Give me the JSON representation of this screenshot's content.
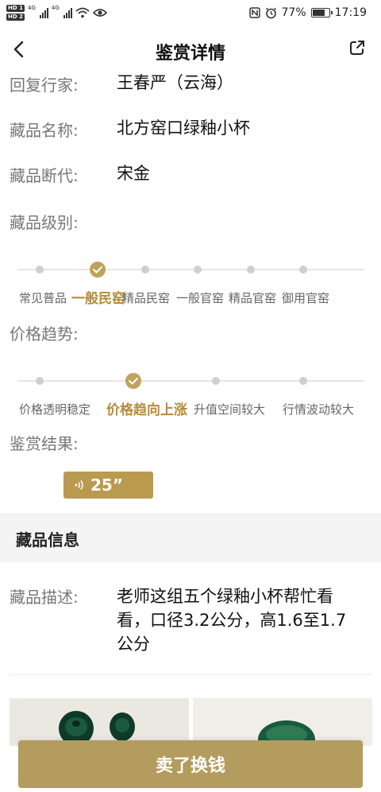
{
  "status_bar": {
    "hd1": "HD 1",
    "hd2": "HD 2",
    "net1": "4G",
    "net2": "4G",
    "battery": "77%",
    "battery_level": 0.77,
    "time": "17:19"
  },
  "header": {
    "title": "鉴赏详情"
  },
  "fields": {
    "expert_label": "回复行家:",
    "expert_value": "王春严（云海）",
    "name_label": "藏品名称:",
    "name_value": "北方窑口绿釉小杯",
    "dating_label": "藏品断代:",
    "dating_value": "宋金",
    "level_label": "藏品级别:",
    "trend_label": "价格趋势:",
    "result_label": "鉴赏结果:"
  },
  "level_steps": {
    "options": [
      "常见普品",
      "一般民窑",
      "精品民窑",
      "一般官窑",
      "精品官窑",
      "御用官窑"
    ],
    "selected_index": 1
  },
  "trend_steps": {
    "options": [
      "价格透明稳定",
      "价格趋向上涨",
      "升值空间较大",
      "行情波动较大"
    ],
    "selected_index": 1
  },
  "voice": {
    "duration": "25”"
  },
  "info_section": {
    "title": "藏品信息",
    "desc_label": "藏品描述:",
    "desc_value": "老师这组五个绿釉小杯帮忙看看，口径3.2公分，高1.6至1.7公分"
  },
  "actions": {
    "sell_label": "卖了换钱"
  },
  "colors": {
    "accent": "#b99a4f",
    "accent_text": "#b58b39",
    "button": "#b39c5e"
  }
}
